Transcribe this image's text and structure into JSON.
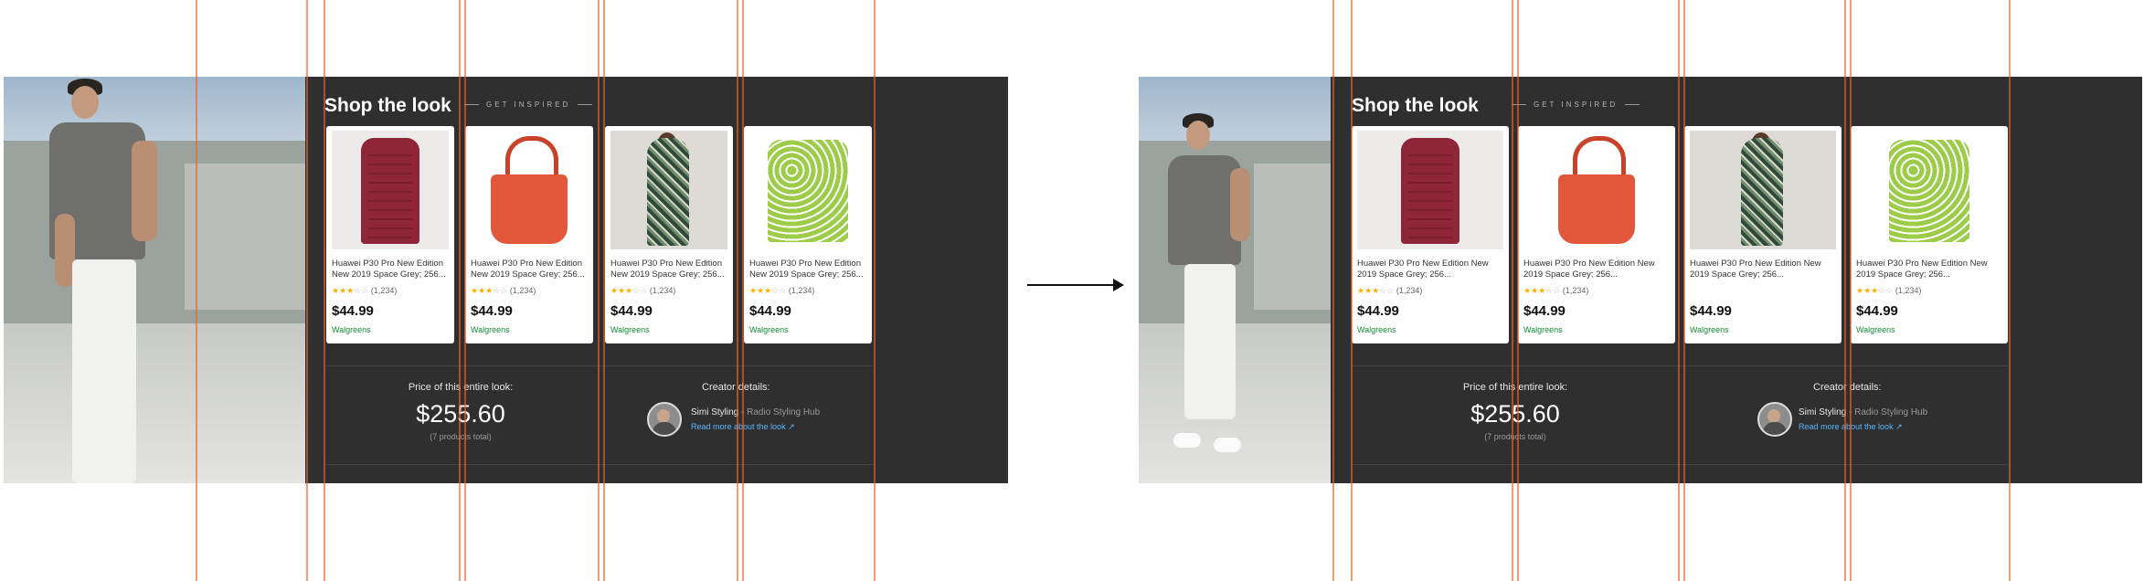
{
  "section_title": "Shop the look",
  "tagline": "GET INSPIRED",
  "products": [
    {
      "image": "red-puffer-jacket",
      "description": "Huawei P30 Pro New Edition New 2019 Space Grey; 256...",
      "rating_count": "(1,234)",
      "stars": 3,
      "price": "$44.99",
      "store": "Walgreens"
    },
    {
      "image": "orange-tote-bag",
      "description": "Huawei P30 Pro New Edition New 2019 Space Grey; 256...",
      "rating_count": "(1,234)",
      "stars": 3,
      "price": "$44.99",
      "store": "Walgreens"
    },
    {
      "image": "floral-dress",
      "description": "Huawei P30 Pro New Edition New 2019 Space Grey; 256...",
      "rating_count": "(1,234)",
      "stars": 3,
      "price": "$44.99",
      "store": "Walgreens"
    },
    {
      "image": "green-print-top",
      "description": "Huawei P30 Pro New Edition New 2019 Space Grey; 256...",
      "rating_count": "(1,234)",
      "stars": 3,
      "price": "$44.99",
      "store": "Walgreens"
    }
  ],
  "price_summary": {
    "title": "Price of this entire look:",
    "value": "$255.60",
    "note": "(7 products total)"
  },
  "creator": {
    "title": "Creator details:",
    "name": "Simi Styling",
    "separator": " - ",
    "hub": "Radio Styling Hub",
    "link": "Read more about the look"
  },
  "colors": {
    "panel": "#2f2f2f",
    "guide": "#ee6230",
    "link": "#58b8ff",
    "store": "#138a36",
    "star": "#f5b400"
  }
}
